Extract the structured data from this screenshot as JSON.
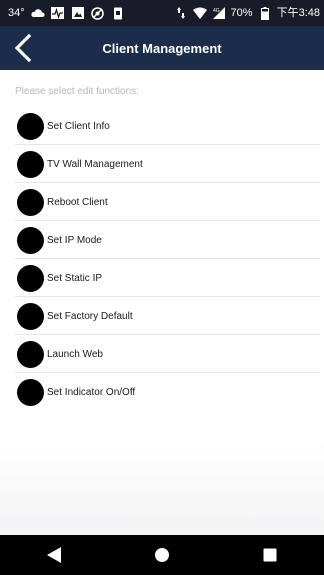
{
  "status_bar": {
    "temperature": "34°",
    "battery_percent": "70%",
    "time": "下午3:48",
    "left_icons": [
      "cloud-icon",
      "activity-icon",
      "image-icon",
      "settings-gear-icon",
      "phone-lock-icon"
    ],
    "right_icons": [
      "data-transfer-icon",
      "wifi-icon",
      "cellular-signal-icon",
      "battery-icon"
    ]
  },
  "app_bar": {
    "title": "Client Management",
    "back_icon": "chevron-left-icon",
    "background_color": "#1b2d4a"
  },
  "content": {
    "hint": "Please select edit functions:",
    "items": [
      {
        "label": "Set Client Info",
        "icon": "black-circle-icon"
      },
      {
        "label": "TV Wall Management",
        "icon": "black-circle-icon"
      },
      {
        "label": "Reboot Client",
        "icon": "black-circle-icon"
      },
      {
        "label": "Set IP Mode",
        "icon": "black-circle-icon"
      },
      {
        "label": "Set Static IP",
        "icon": "black-circle-icon"
      },
      {
        "label": "Set Factory Default",
        "icon": "black-circle-icon"
      },
      {
        "label": "Launch Web",
        "icon": "black-circle-icon"
      },
      {
        "label": "Set Indicator On/Off",
        "icon": "black-circle-icon"
      }
    ]
  },
  "nav_bar": {
    "icons": [
      "back-triangle-icon",
      "home-circle-icon",
      "recents-square-icon"
    ]
  }
}
